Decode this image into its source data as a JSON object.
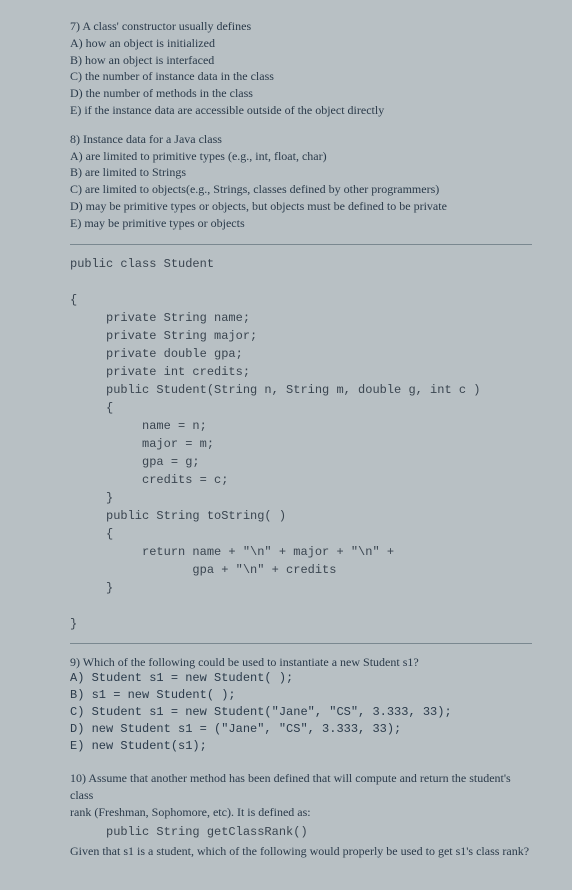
{
  "q7": {
    "prompt": "7) A class' constructor usually defines",
    "a": "A) how an object is initialized",
    "b": "B) how an object is interfaced",
    "c": "C) the number of instance data in the class",
    "d": "D) the number of methods in the class",
    "e": "E) if the instance data are accessible outside of the object directly"
  },
  "q8": {
    "prompt": "8) Instance data for a Java class",
    "a": "A) are limited to primitive types (e.g., int, float, char)",
    "b": "B) are limited to Strings",
    "c": "C) are limited to objects(e.g., Strings, classes defined by other programmers)",
    "d": "D) may be primitive types or objects, but objects must be defined to be private",
    "e": "E) may be primitive types or objects"
  },
  "code": "public class Student\n\n{\n     private String name;\n     private String major;\n     private double gpa;\n     private int credits;\n     public Student(String n, String m, double g, int c )\n     {\n          name = n;\n          major = m;\n          gpa = g;\n          credits = c;\n     }\n     public String toString( )\n     {\n          return name + \"\\n\" + major + \"\\n\" +\n                 gpa + \"\\n\" + credits\n     }\n\n}",
  "q9": {
    "prompt": "9) Which of the following could be used to instantiate a new Student s1?",
    "a": "A) Student s1 = new Student( );",
    "b": "B) s1 = new Student( );",
    "c": "C) Student s1 = new Student(\"Jane\", \"CS\", 3.333, 33);",
    "d": "D) new Student s1 = (\"Jane\", \"CS\", 3.333, 33);",
    "e": "E) new Student(s1);"
  },
  "q10": {
    "line1": "10) Assume that another method has been defined that will compute and return the student's class",
    "line2": "rank (Freshman, Sophomore, etc). It is defined as:",
    "code": "     public String getClassRank()",
    "line3": "Given that s1 is a student, which of the following would properly be used to get s1's class rank?"
  }
}
